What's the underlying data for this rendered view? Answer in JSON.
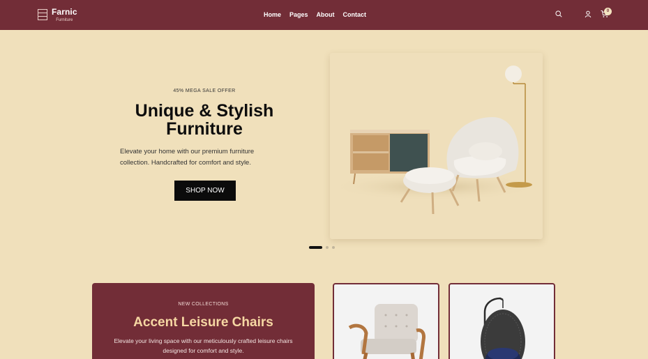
{
  "brand": {
    "name": "Farnic",
    "tagline": "Furniture"
  },
  "nav": {
    "items": [
      "Home",
      "Pages",
      "About",
      "Contact"
    ]
  },
  "header_icons": {
    "search": "search-icon",
    "account": "user-icon",
    "cart": "cart-icon",
    "cart_count": "0"
  },
  "hero": {
    "kicker": "45% MEGA SALE OFFER",
    "title_line1": "Unique & Stylish",
    "title_line2": "Furniture",
    "desc_line1": "Elevate your home with our premium furniture",
    "desc_line2": "collection. Handcrafted for comfort and style.",
    "cta": "SHOP NOW"
  },
  "carousel": {
    "slides": 3,
    "active": 1
  },
  "collection": {
    "kicker": "NEW COLLECTIONS",
    "title": "Accent Leisure Chairs",
    "desc_line1": "Elevate your living space with our meticulously crafted leisure chairs",
    "desc_line2": "designed for comfort and style."
  },
  "colors": {
    "primary": "#722d37",
    "background": "#f0e0bb",
    "accent": "#f6d7a3",
    "button": "#0b0b0b"
  }
}
